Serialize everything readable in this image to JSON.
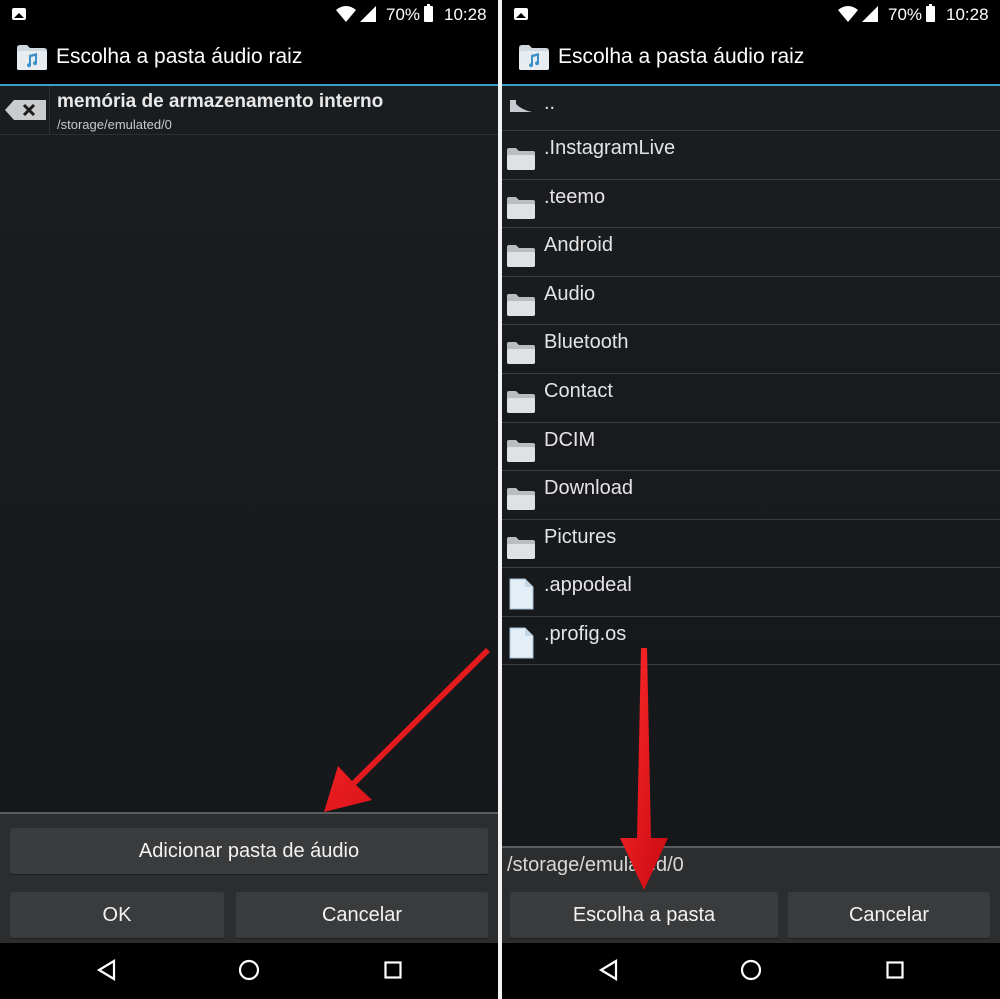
{
  "status_bar": {
    "battery_percent": "70%",
    "time": "10:28"
  },
  "dialog": {
    "title": "Escolha a pasta áudio raiz",
    "app_icon": "music-folder-icon"
  },
  "left_panel": {
    "storage": {
      "name": "memória de armazenamento interno",
      "path": "/storage/emulated/0",
      "remove_icon": "backspace-icon"
    },
    "buttons": {
      "add_folder": "Adicionar pasta de áudio",
      "ok": "OK",
      "cancel": "Cancelar"
    }
  },
  "right_panel": {
    "parent_dir_label": "..",
    "items": [
      {
        "name": ".InstagramLive",
        "type": "folder"
      },
      {
        "name": ".teemo",
        "type": "folder"
      },
      {
        "name": "Android",
        "type": "folder"
      },
      {
        "name": "Audio",
        "type": "folder"
      },
      {
        "name": "Bluetooth",
        "type": "folder"
      },
      {
        "name": "Contact",
        "type": "folder"
      },
      {
        "name": "DCIM",
        "type": "folder"
      },
      {
        "name": "Download",
        "type": "folder"
      },
      {
        "name": "Pictures",
        "type": "folder"
      },
      {
        "name": ".appodeal",
        "type": "file"
      },
      {
        "name": ".profig.os",
        "type": "file"
      }
    ],
    "current_path": "/storage/emulated/0",
    "buttons": {
      "choose": "Escolha a pasta",
      "cancel": "Cancelar"
    }
  },
  "colors": {
    "accent_line": "#3a9fc7",
    "annotation_arrow": "#e0101a",
    "background": "#181a1d"
  },
  "nav_icons": [
    "back-icon",
    "home-icon",
    "recent-apps-icon"
  ]
}
